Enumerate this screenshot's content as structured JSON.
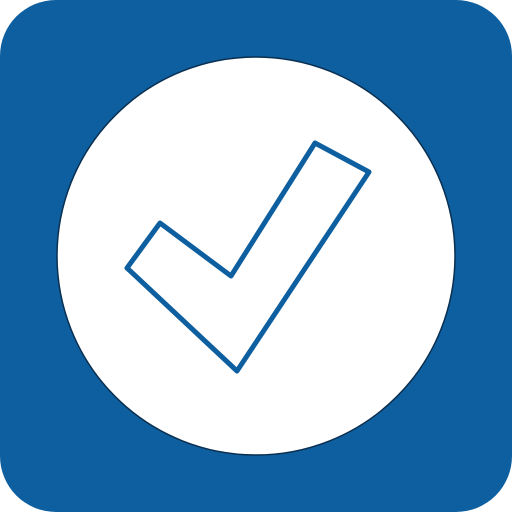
{
  "icon": {
    "name": "checkmark-app-icon",
    "symbol": "checkmark-icon"
  },
  "colors": {
    "tile": "#0E5F9F",
    "circle": "#FFFFFF",
    "circle_outline": "#0A2F50",
    "check_fill": "#FFFFFF",
    "check_stroke": "#0E5F9F"
  }
}
